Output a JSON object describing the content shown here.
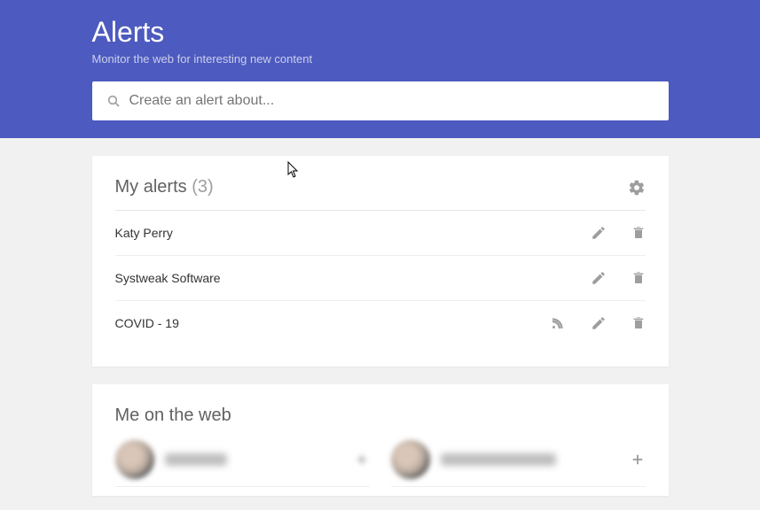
{
  "header": {
    "title": "Alerts",
    "subtitle": "Monitor the web for interesting new content",
    "search_placeholder": "Create an alert about..."
  },
  "my_alerts": {
    "title": "My alerts",
    "count": "(3)",
    "items": [
      {
        "name": "Katy Perry",
        "has_rss": false
      },
      {
        "name": "Systweak Software",
        "has_rss": false
      },
      {
        "name": "COVID - 19",
        "has_rss": true
      }
    ]
  },
  "me_on_web": {
    "title": "Me on the web"
  }
}
